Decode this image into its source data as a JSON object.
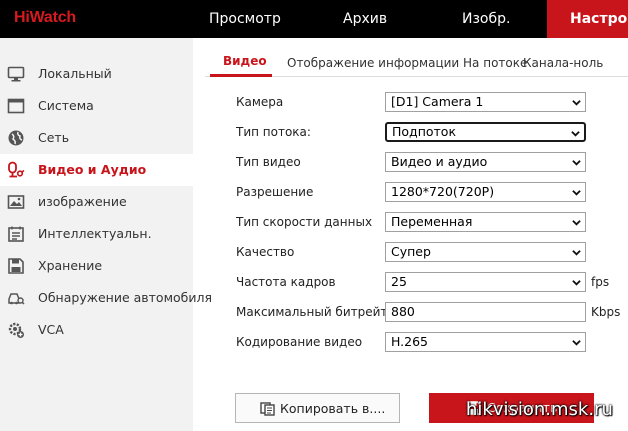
{
  "brand": {
    "logo": "HiWatch"
  },
  "topnav": {
    "items": [
      {
        "label": "Просмотр"
      },
      {
        "label": "Архив"
      },
      {
        "label": "Изобр."
      },
      {
        "label": "Настрой"
      }
    ],
    "active_color": "#c8141b"
  },
  "sidebar": {
    "items": [
      {
        "label": "Локальный",
        "icon": "monitor-icon"
      },
      {
        "label": "Система",
        "icon": "system-window-icon"
      },
      {
        "label": "Сеть",
        "icon": "globe-icon"
      },
      {
        "label": "Видео и Аудио",
        "icon": "microphone-icon"
      },
      {
        "label": "изображение",
        "icon": "image-icon"
      },
      {
        "label": "Интеллектуальн.",
        "icon": "calendar-list-icon"
      },
      {
        "label": "Хранение",
        "icon": "floppy-disk-icon"
      },
      {
        "label": "Обнаружение автомобиля",
        "icon": "car-search-icon"
      },
      {
        "label": "VCA",
        "icon": "gear-plus-icon"
      }
    ]
  },
  "tabs": [
    {
      "label": "Видео"
    },
    {
      "label": "Отображение информации На потоке"
    },
    {
      "label": "Канала-ноль"
    }
  ],
  "form": {
    "camera": {
      "label": "Камера",
      "value": "[D1] Camera 1"
    },
    "stream_type": {
      "label": "Тип потока:",
      "value": "Подпоток"
    },
    "video_type": {
      "label": "Тип видео",
      "value": "Видео и аудио"
    },
    "resolution": {
      "label": "Разрешение",
      "value": "1280*720(720P)"
    },
    "bitrate_type": {
      "label": "Тип скорости данных",
      "value": "Переменная"
    },
    "quality": {
      "label": "Качество",
      "value": "Супер"
    },
    "frame_rate": {
      "label": "Частота кадров",
      "value": "25",
      "unit": "fps"
    },
    "max_bitrate": {
      "label": "Максимальный битрейт",
      "value": "880",
      "unit": "Kbps"
    },
    "encoding": {
      "label": "Кодирование видео",
      "value": "H.265"
    }
  },
  "buttons": {
    "copy": "Копировать в....",
    "save": "Сохранить"
  },
  "watermark": "hikvision.msk.ru"
}
